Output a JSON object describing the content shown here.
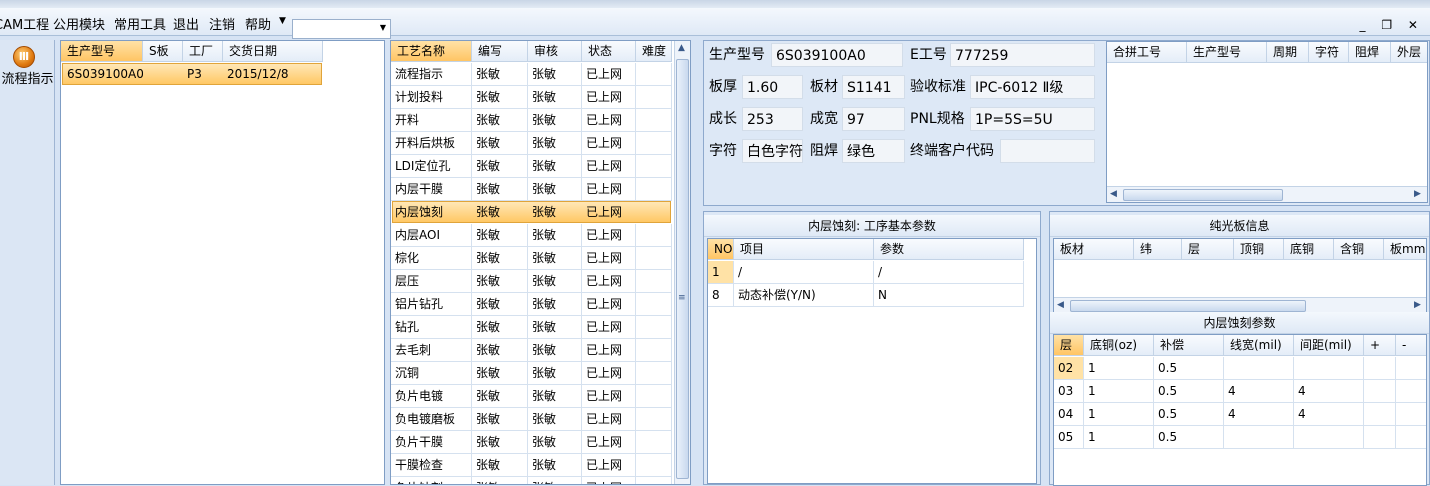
{
  "menu": {
    "items": [
      "CAM工程",
      "公用模块",
      "常用工具",
      "退出",
      "注销",
      "帮助"
    ],
    "combo_value": ""
  },
  "window_controls": "_ ❐ ✕",
  "left_nav": {
    "label": "流程指示"
  },
  "orders": {
    "headers": [
      "生产型号",
      "S板",
      "工厂",
      "交货日期"
    ],
    "rows": [
      {
        "model": "6S039100A0",
        "s": "",
        "factory": "P3",
        "date": "2015/12/8"
      }
    ]
  },
  "processes": {
    "headers": [
      "工艺名称",
      "编写",
      "审核",
      "状态",
      "难度"
    ],
    "rows": [
      [
        "流程指示",
        "张敏",
        "张敏",
        "已上网",
        ""
      ],
      [
        "计划投料",
        "张敏",
        "张敏",
        "已上网",
        ""
      ],
      [
        "开料",
        "张敏",
        "张敏",
        "已上网",
        ""
      ],
      [
        "开料后烘板",
        "张敏",
        "张敏",
        "已上网",
        ""
      ],
      [
        "LDI定位孔",
        "张敏",
        "张敏",
        "已上网",
        ""
      ],
      [
        "内层干膜",
        "张敏",
        "张敏",
        "已上网",
        ""
      ],
      [
        "内层蚀刻",
        "张敏",
        "张敏",
        "已上网",
        ""
      ],
      [
        "内层AOI",
        "张敏",
        "张敏",
        "已上网",
        ""
      ],
      [
        "棕化",
        "张敏",
        "张敏",
        "已上网",
        ""
      ],
      [
        "层压",
        "张敏",
        "张敏",
        "已上网",
        ""
      ],
      [
        "铝片钻孔",
        "张敏",
        "张敏",
        "已上网",
        ""
      ],
      [
        "钻孔",
        "张敏",
        "张敏",
        "已上网",
        ""
      ],
      [
        "去毛刺",
        "张敏",
        "张敏",
        "已上网",
        ""
      ],
      [
        "沉铜",
        "张敏",
        "张敏",
        "已上网",
        ""
      ],
      [
        "负片电镀",
        "张敏",
        "张敏",
        "已上网",
        ""
      ],
      [
        "负电镀磨板",
        "张敏",
        "张敏",
        "已上网",
        ""
      ],
      [
        "负片干膜",
        "张敏",
        "张敏",
        "已上网",
        ""
      ],
      [
        "干膜检查",
        "张敏",
        "张敏",
        "已上网",
        ""
      ],
      [
        "负片蚀刻",
        "张敏",
        "张敏",
        "已上网",
        ""
      ]
    ],
    "selected_index": 6
  },
  "info": {
    "fields": [
      {
        "label": "生产型号",
        "value": "6S039100A0"
      },
      {
        "label": "E工号",
        "value": "777259"
      },
      {
        "label": "板厚",
        "value": "1.60"
      },
      {
        "label": "板材",
        "value": "S1141"
      },
      {
        "label": "验收标准",
        "value": "IPC-6012 Ⅱ级"
      },
      {
        "label": "成长",
        "value": "253"
      },
      {
        "label": "成宽",
        "value": "97"
      },
      {
        "label": "PNL规格",
        "value": "1P=5S=5U"
      },
      {
        "label": "字符",
        "value": "白色字符"
      },
      {
        "label": "阻焊",
        "value": "绿色"
      },
      {
        "label": "终端客户代码",
        "value": ""
      }
    ]
  },
  "panel_grid": {
    "headers": [
      "合拼工号",
      "生产型号",
      "周期",
      "字符",
      "阻焊",
      "外层"
    ]
  },
  "step_params": {
    "title": "内层蚀刻: 工序基本参数",
    "headers": [
      "NO",
      "项目",
      "参数"
    ],
    "rows": [
      [
        "1",
        "/",
        "/"
      ],
      [
        "8",
        "动态补偿(Y/N)",
        "N"
      ]
    ]
  },
  "bare_board": {
    "title": "纯光板信息",
    "headers": [
      "板材",
      "纬",
      "层",
      "顶铜",
      "底铜",
      "含铜",
      "板mm"
    ]
  },
  "etch_params": {
    "title": "内层蚀刻参数",
    "headers": [
      "层",
      "底铜(oz)",
      "补偿",
      "线宽(mil)",
      "间距(mil)",
      "+",
      "-"
    ],
    "rows": [
      [
        "02",
        "1",
        "0.5",
        "",
        "",
        "",
        ""
      ],
      [
        "03",
        "1",
        "0.5",
        "4",
        "4",
        "",
        ""
      ],
      [
        "04",
        "1",
        "0.5",
        "4",
        "4",
        "",
        ""
      ],
      [
        "05",
        "1",
        "0.5",
        "",
        "",
        "",
        ""
      ]
    ]
  }
}
